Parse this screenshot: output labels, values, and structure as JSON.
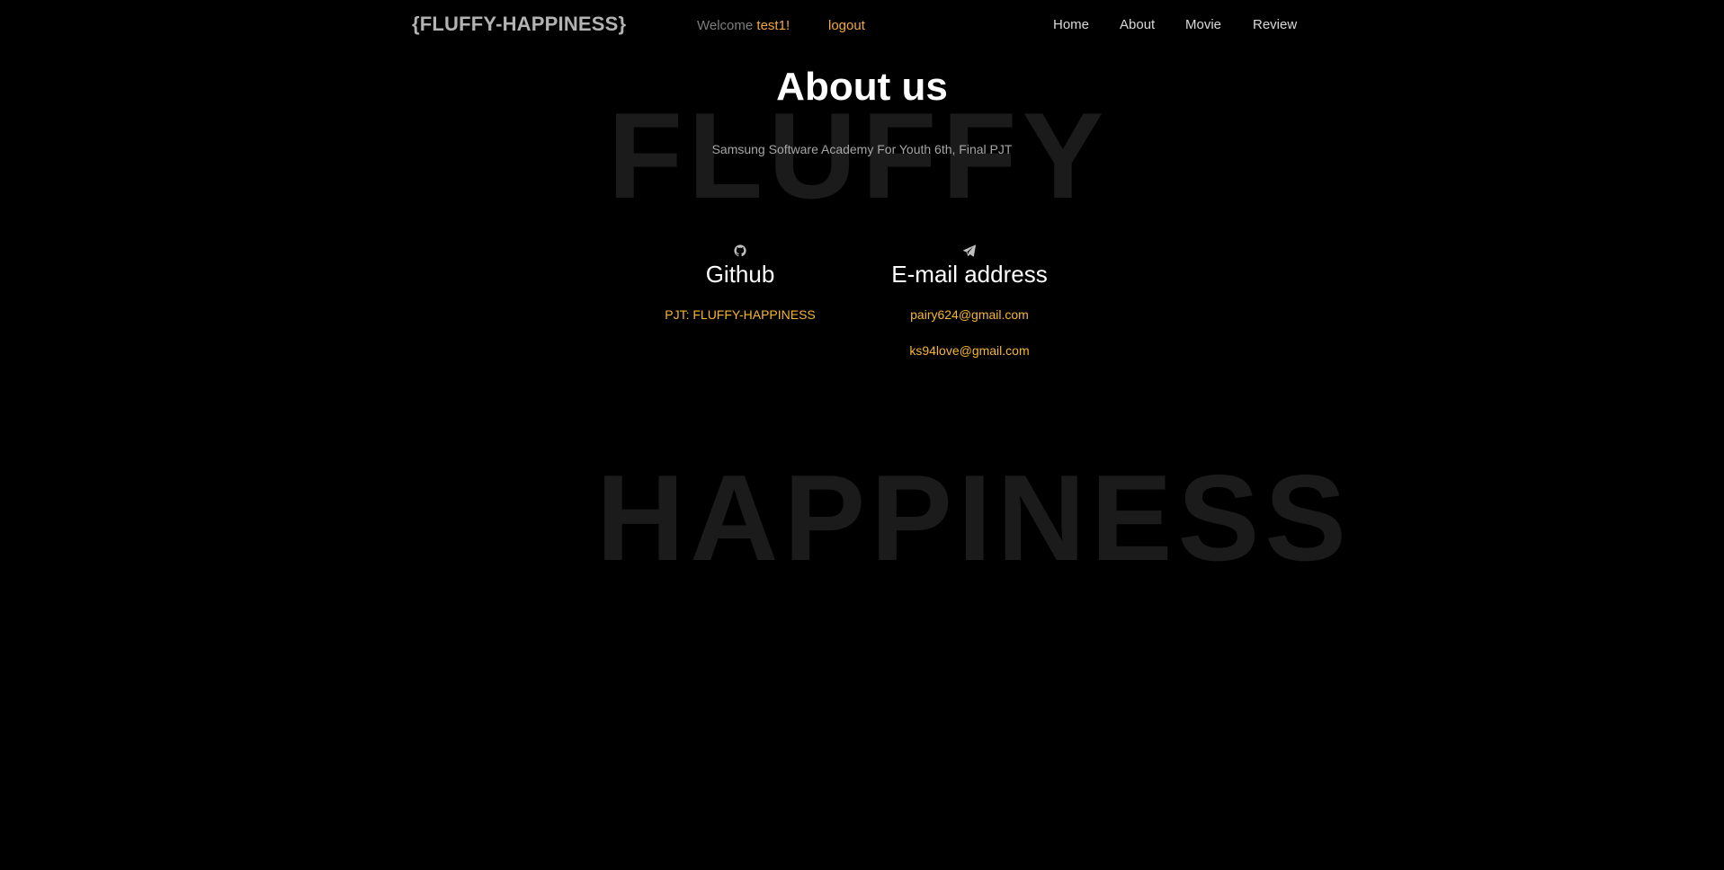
{
  "header": {
    "brand": "{FLUFFY-HAPPINESS}",
    "welcome_prefix": "Welcome ",
    "username": "test1!",
    "logout_label": "logout",
    "nav": [
      {
        "label": "Home"
      },
      {
        "label": "About"
      },
      {
        "label": "Movie"
      },
      {
        "label": "Review"
      }
    ]
  },
  "background": {
    "word_top": "FLUFFY",
    "word_bottom": "HAPPINESS"
  },
  "main": {
    "title": "About us",
    "subtitle": "Samsung Software Academy For Youth 6th, Final PJT",
    "github": {
      "icon": "github-icon",
      "heading": "Github",
      "links": [
        "PJT: FLUFFY-HAPPINESS"
      ]
    },
    "email": {
      "icon": "paper-plane-icon",
      "heading": "E-mail address",
      "links": [
        "pairy624@gmail.com",
        "ks94love@gmail.com"
      ]
    }
  },
  "colors": {
    "background": "#000000",
    "accent": "#f5b731",
    "brand": "#b3b3b3",
    "watermark": "#1b1b1b"
  }
}
